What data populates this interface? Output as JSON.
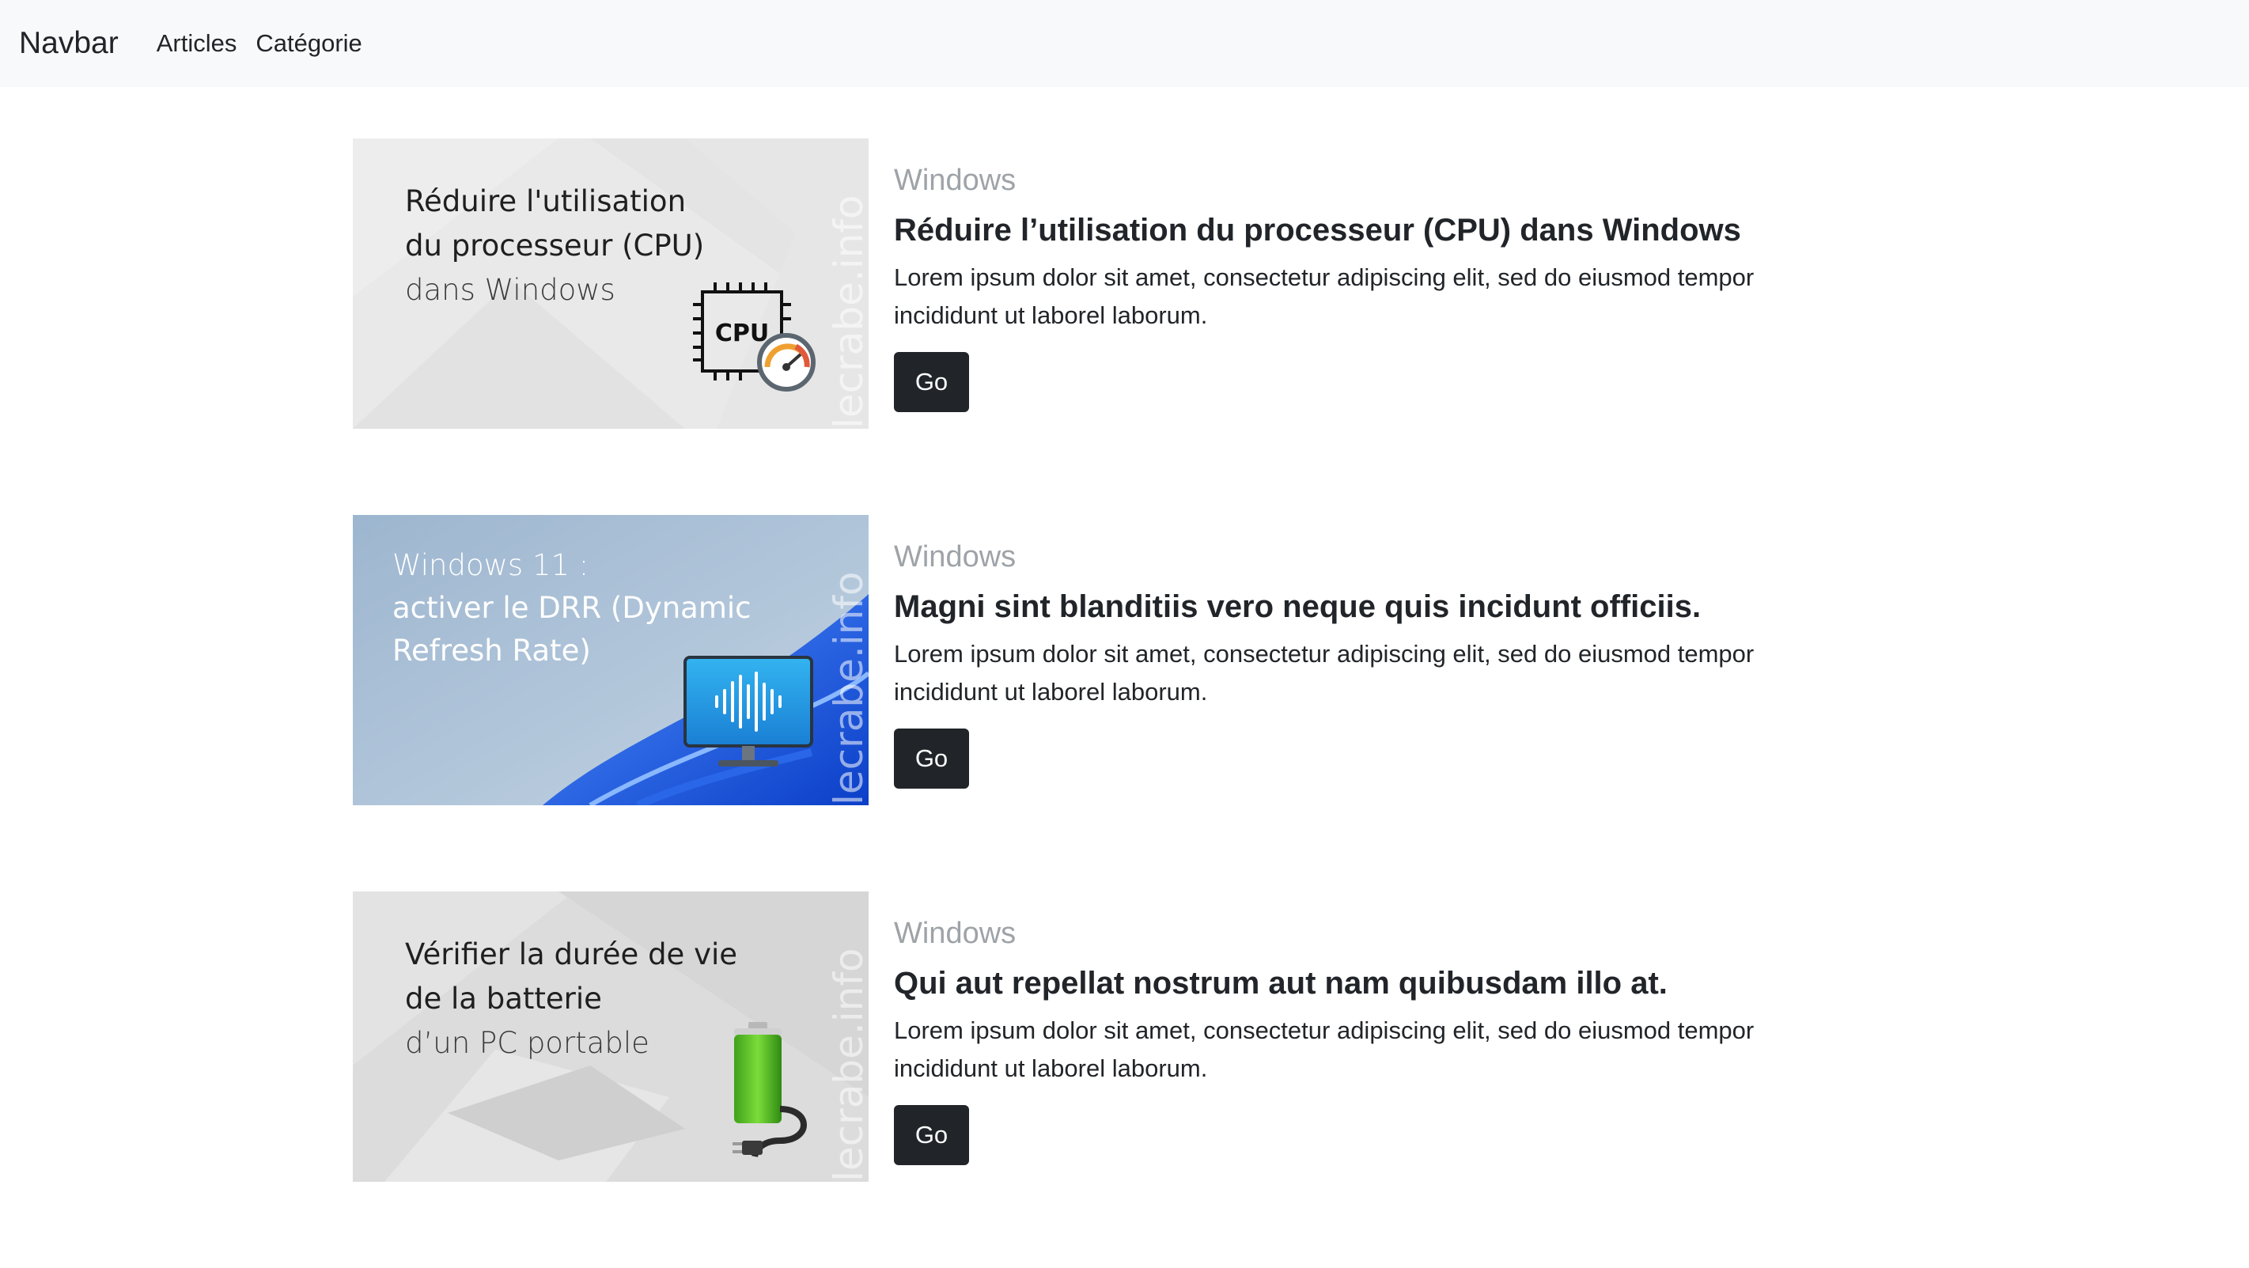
{
  "navbar": {
    "brand": "Navbar",
    "links": [
      "Articles",
      "Catégorie"
    ]
  },
  "watermark": "lecrabe.info",
  "articles": [
    {
      "image_lines": [
        "Réduire l'utilisation",
        "du processeur (CPU)",
        "dans Windows"
      ],
      "image_badge": "CPU",
      "category": "Windows",
      "title": "Réduire l’utilisation du processeur (CPU) dans Windows",
      "text": "Lorem ipsum dolor sit amet, consectetur adipiscing elit, sed do eiusmod tempor incididunt ut laborel laborum.",
      "button": "Go"
    },
    {
      "image_lines": [
        "Windows 11 :",
        "activer le DRR (Dynamic",
        "Refresh Rate)"
      ],
      "category": "Windows",
      "title": "Magni sint blanditiis vero neque quis incidunt officiis.",
      "text": "Lorem ipsum dolor sit amet, consectetur adipiscing elit, sed do eiusmod tempor incididunt ut laborel laborum.",
      "button": "Go"
    },
    {
      "image_lines": [
        "Vérifier la durée de vie",
        "de la batterie",
        "d’un PC portable"
      ],
      "category": "Windows",
      "title": "Qui aut repellat nostrum aut nam quibusdam illo at.",
      "text": "Lorem ipsum dolor sit amet, consectetur adipiscing elit, sed do eiusmod tempor incididunt ut laborel laborum.",
      "button": "Go"
    }
  ],
  "colors": {
    "navbar_bg": "#f8f9fa",
    "button_bg": "#212529",
    "category_text": "#9ea3a8"
  },
  "icons": [
    "cpu-icon",
    "speedometer-icon",
    "monitor-soundwave-icon",
    "battery-icon",
    "power-plug-icon"
  ]
}
